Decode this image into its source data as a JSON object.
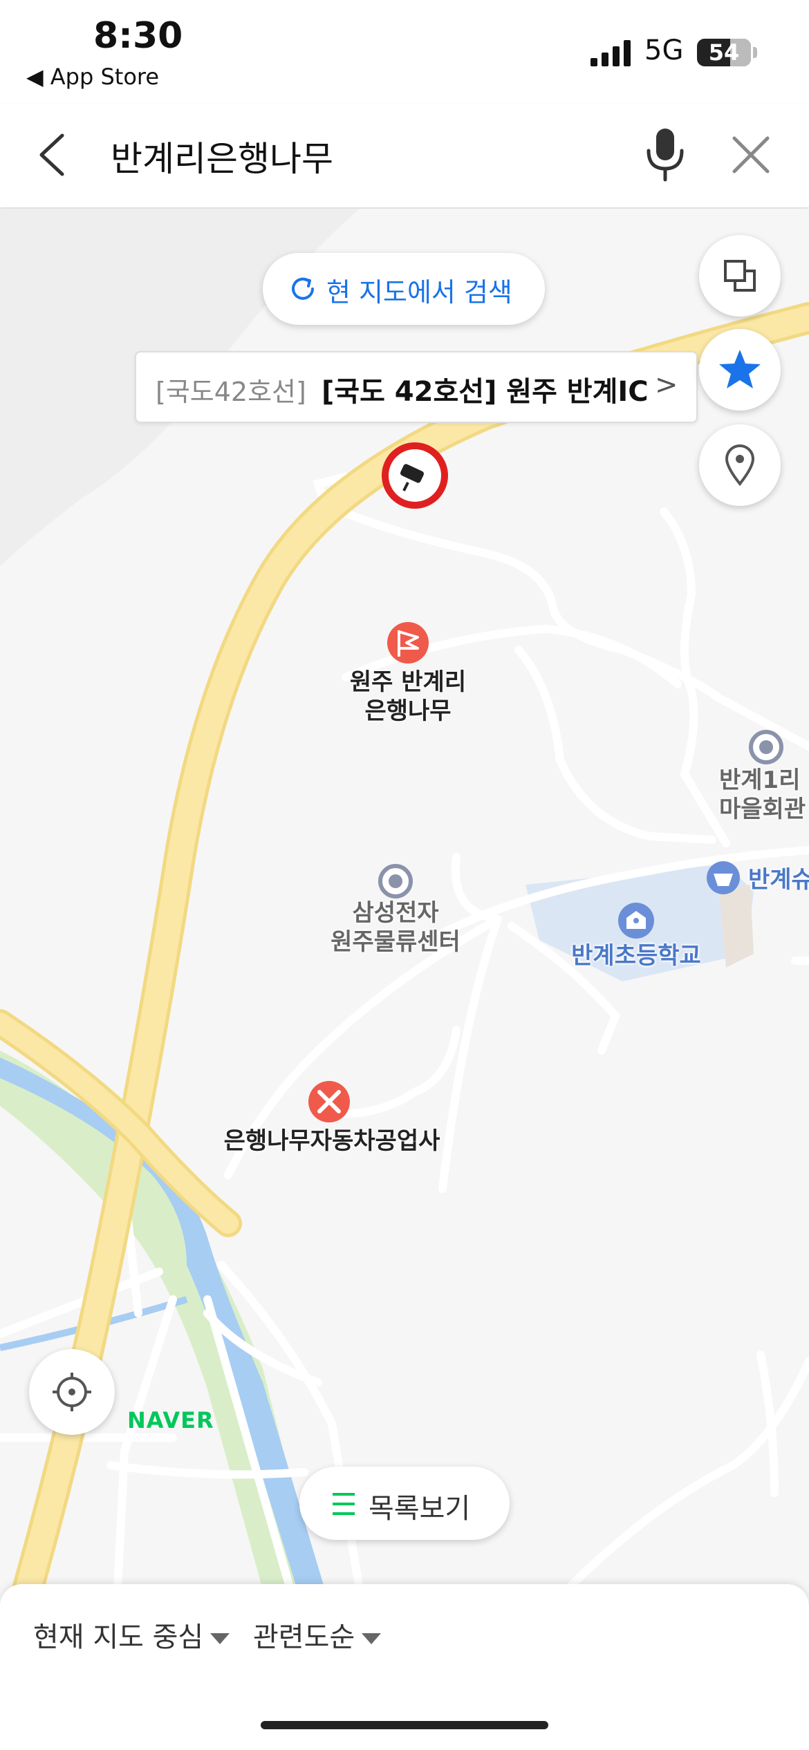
{
  "status_bar": {
    "time": "8:30",
    "back_app": "◀ App Store",
    "network": "5G",
    "battery": "54"
  },
  "search": {
    "query": "반계리은행나무",
    "icons": [
      "back-arrow-icon",
      "microphone-icon",
      "close-icon"
    ]
  },
  "map": {
    "search_here_label": "현 지도에서 검색",
    "road_tooltip": {
      "prefix": "[국도42호선]",
      "title": "[국도 42호선] 원주 반계IC",
      "chevron": ">"
    },
    "pois": [
      {
        "name": "원주 반계리\n은행나무",
        "icon": "flag-icon",
        "color": "#f05a4b"
      },
      {
        "name": "반계1리\n마을회관",
        "icon": "place-dot-icon",
        "color": "#8a93aa"
      },
      {
        "name": "반계슈",
        "icon": "store-icon",
        "color": "#6a8fd8"
      },
      {
        "name": "삼성전자\n원주물류센터",
        "icon": "place-dot-icon",
        "color": "#8a93aa"
      },
      {
        "name": "반계초등학교",
        "icon": "school-icon",
        "color": "#6a8fd8"
      },
      {
        "name": "은행나무자동차공업사",
        "icon": "repair-icon",
        "color": "#f05a4b"
      }
    ],
    "brand": "NAVER",
    "list_button": "목록보기",
    "colors": {
      "highway": "#fbe8a6",
      "highway_edge": "#f2d982",
      "river": "#a7cdf2",
      "park": "#d9eec8",
      "school_zone": "#dbe6f5",
      "accent_blue": "#1a73e8",
      "naver_green": "#03c75a"
    }
  },
  "bottom_sheet": {
    "filter_center": "현재 지도 중심",
    "filter_sort": "관련도순"
  }
}
